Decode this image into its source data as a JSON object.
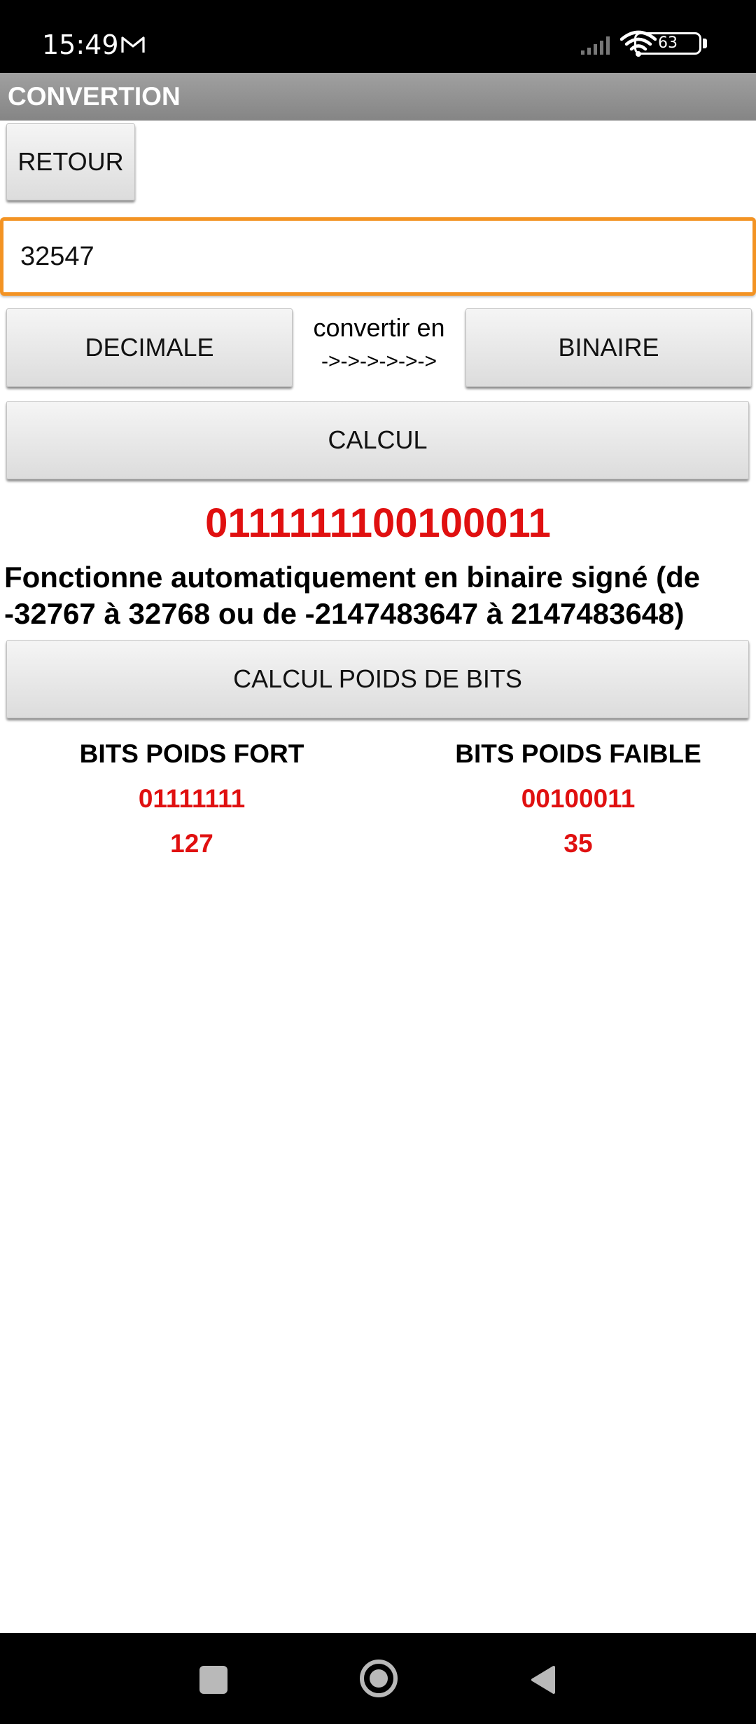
{
  "status_bar": {
    "time": "15:49",
    "battery_level": "63",
    "icons": [
      "gmail-icon",
      "signal-icon",
      "wifi-icon",
      "battery-icon"
    ]
  },
  "app": {
    "title": "CONVERTION"
  },
  "buttons": {
    "retour": "RETOUR",
    "decimale": "DECIMALE",
    "binaire": "BINAIRE",
    "calcul": "CALCUL",
    "calcul_poids": "CALCUL POIDS DE BITS"
  },
  "input": {
    "value": "32547"
  },
  "convert": {
    "label": "convertir en",
    "arrows": "->->->->->->"
  },
  "result": {
    "binary": "0111111100100011",
    "info": "Fonctionne automatiquement en binaire signé (de -32767 à 32768 ou de -2147483647 à 2147483648)"
  },
  "bits": {
    "strong": {
      "title": "BITS POIDS FORT",
      "binary": "01111111",
      "decimal": "127"
    },
    "weak": {
      "title": "BITS POIDS FAIBLE",
      "binary": "00100011",
      "decimal": "35"
    }
  },
  "nav_bar": {
    "icons": [
      "recents-icon",
      "home-icon",
      "back-icon"
    ]
  },
  "colors": {
    "accent_border": "#f39323",
    "result_red": "#e01010",
    "title_bar": "#999999"
  }
}
